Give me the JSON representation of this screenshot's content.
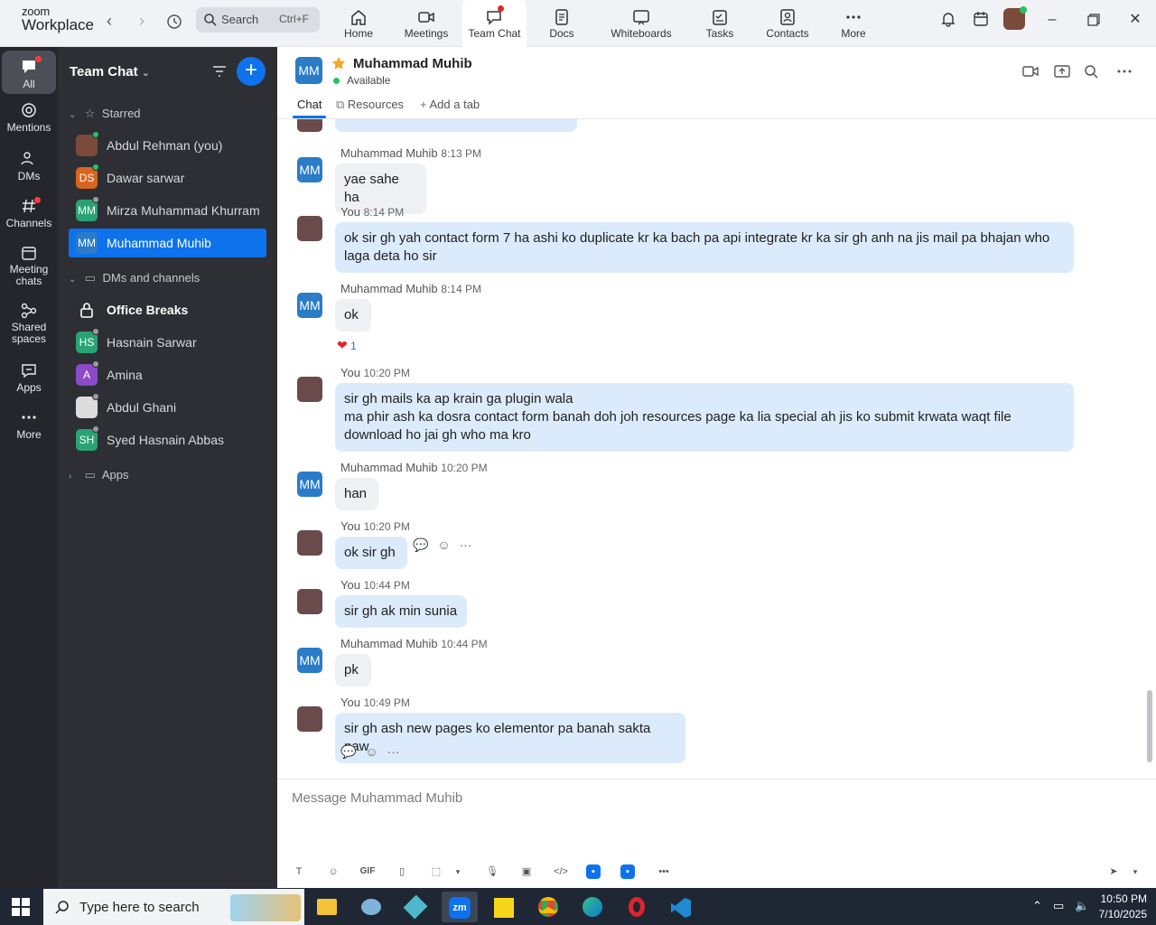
{
  "app": {
    "logo_line1": "zoom",
    "logo_line2": "Workplace",
    "search_label": "Search",
    "search_shortcut": "Ctrl+F",
    "tabs": [
      {
        "label": "Home",
        "icon": "home-icon"
      },
      {
        "label": "Meetings",
        "icon": "video-icon"
      },
      {
        "label": "Team Chat",
        "icon": "chat-icon",
        "active": true
      },
      {
        "label": "Docs",
        "icon": "docs-icon"
      },
      {
        "label": "Whiteboards",
        "icon": "whiteboard-icon"
      },
      {
        "label": "Tasks",
        "icon": "tasks-icon"
      },
      {
        "label": "Contacts",
        "icon": "contacts-icon"
      },
      {
        "label": "More",
        "icon": "more-icon"
      }
    ]
  },
  "rail": [
    {
      "label": "All",
      "icon": "chat-bubble-icon"
    },
    {
      "label": "Mentions",
      "icon": "at-icon"
    },
    {
      "label": "DMs",
      "icon": "people-icon"
    },
    {
      "label": "Channels",
      "icon": "hash-icon"
    },
    {
      "label": "Meeting chats",
      "icon": "calendar-icon"
    },
    {
      "label": "Shared spaces",
      "icon": "share-icon"
    },
    {
      "label": "Apps",
      "icon": "apps-icon"
    },
    {
      "label": "More",
      "icon": "more-icon"
    }
  ],
  "sidebar": {
    "title": "Team Chat",
    "starred_label": "Starred",
    "starred": [
      {
        "name": "Abdul Rehman (you)",
        "initials": "",
        "color": "#7a4a3a",
        "status": "#23c45e"
      },
      {
        "name": "Dawar sarwar",
        "initials": "DS",
        "color": "#d8641f",
        "status": "#23c45e"
      },
      {
        "name": "Mirza Muhammad Khurram",
        "initials": "MM",
        "color": "#2aa374",
        "status": "#9a9aa0"
      },
      {
        "name": "Muhammad Muhib",
        "initials": "MM",
        "color": "#2a7cc7",
        "status": ""
      }
    ],
    "dms_label": "DMs and channels",
    "dms": [
      {
        "name": "Office Breaks",
        "initials": "",
        "color": "",
        "status": ""
      },
      {
        "name": "Hasnain Sarwar",
        "initials": "HS",
        "color": "#2aa374",
        "status": "#9a9aa0"
      },
      {
        "name": "Amina",
        "initials": "A",
        "color": "#8b4ac7",
        "status": "#9a9aa0"
      },
      {
        "name": "Abdul Ghani",
        "initials": "",
        "color": "#dcdcdc",
        "status": "#9a9aa0"
      },
      {
        "name": "Syed Hasnain Abbas",
        "initials": "SH",
        "color": "#2aa374",
        "status": "#9a9aa0"
      }
    ],
    "apps_label": "Apps"
  },
  "chat": {
    "contact_initials": "MM",
    "contact_name": "Muhammad Muhib",
    "status": "Available",
    "tabs": [
      "Chat",
      "Resources",
      "Add a tab"
    ],
    "messages": [
      {
        "sender": "Muhammad Muhib",
        "time": "8:13 PM",
        "text": [
          "yae sahe ha"
        ],
        "mine": false
      },
      {
        "sender": "You",
        "time": "8:14 PM",
        "text": [
          "ok sir gh yah contact form 7 ha ashi ko duplicate kr ka bach pa api integrate kr ka sir gh anh na jis mail pa bhajan who",
          "laga deta ho sir"
        ],
        "mine": true
      },
      {
        "sender": "Muhammad Muhib",
        "time": "8:14 PM",
        "text": [
          "ok"
        ],
        "mine": false,
        "reaction": "1"
      },
      {
        "sender": "You",
        "time": "10:20 PM",
        "text": [
          "sir gh mails ka ap krain ga plugin wala",
          "ma phir ash ka dosra contact form banah doh joh resources page ka lia special ah jis ko submit krwata waqt file",
          "download ho jai gh who ma kro"
        ],
        "mine": true
      },
      {
        "sender": "Muhammad Muhib",
        "time": "10:20 PM",
        "text": [
          "han"
        ],
        "mine": false
      },
      {
        "sender": "You",
        "time": "10:20 PM",
        "text": [
          "ok sir gh"
        ],
        "mine": true
      },
      {
        "sender": "You",
        "time": "10:44 PM",
        "text": [
          "sir gh ak min sunia"
        ],
        "mine": true
      },
      {
        "sender": "Muhammad Muhib",
        "time": "10:44 PM",
        "text": [
          "pk"
        ],
        "mine": false
      },
      {
        "sender": "You",
        "time": "10:49 PM",
        "text": [
          "sir gh ash new pages ko elementor pa banah sakta naw"
        ],
        "mine": true
      }
    ],
    "composer_placeholder": "Message Muhammad Muhib",
    "gif_label": "GIF"
  },
  "taskbar": {
    "search_placeholder": "Type here to search",
    "time": "10:50 PM",
    "date": "7/10/2025"
  }
}
